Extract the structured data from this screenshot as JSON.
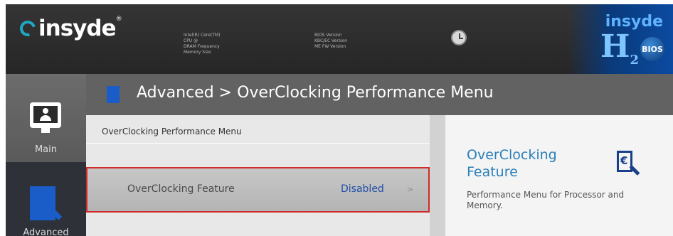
{
  "header": {
    "logo_text": "insyde",
    "logo_mark": "®",
    "cpu_info": [
      "Intel(R) Core(TM)",
      "CPU @",
      "DRAM Frequency",
      "Memory Size"
    ],
    "bios_info": [
      "BIOS Version",
      "KBC/EC Version",
      "ME FW Version"
    ],
    "brand": {
      "insyde": "insyde",
      "h2": "H",
      "sub": "2",
      "bios": "BIOS"
    }
  },
  "sidebar": {
    "items": [
      {
        "label": "Main",
        "icon": "monitor-user-icon"
      },
      {
        "label": "Advanced",
        "icon": "document-magnifier-icon"
      }
    ]
  },
  "titlebar": {
    "title": "Advanced > OverClocking Performance Menu",
    "icon": "document-magnifier-icon"
  },
  "content": {
    "heading": "OverClocking Performance Menu",
    "rows": [
      {
        "label": "OverClocking Feature",
        "value": "Disabled",
        "arrow": ">"
      }
    ]
  },
  "help": {
    "title": "OverClocking Feature",
    "description": "Performance Menu for Processor and Memory.",
    "icon": "euro-document-magnifier-icon"
  },
  "colors": {
    "selection_border": "#d12a2a",
    "value_text": "#1f4ea8",
    "help_title": "#2c7fb8",
    "accent_blue": "#1a5cc8"
  }
}
